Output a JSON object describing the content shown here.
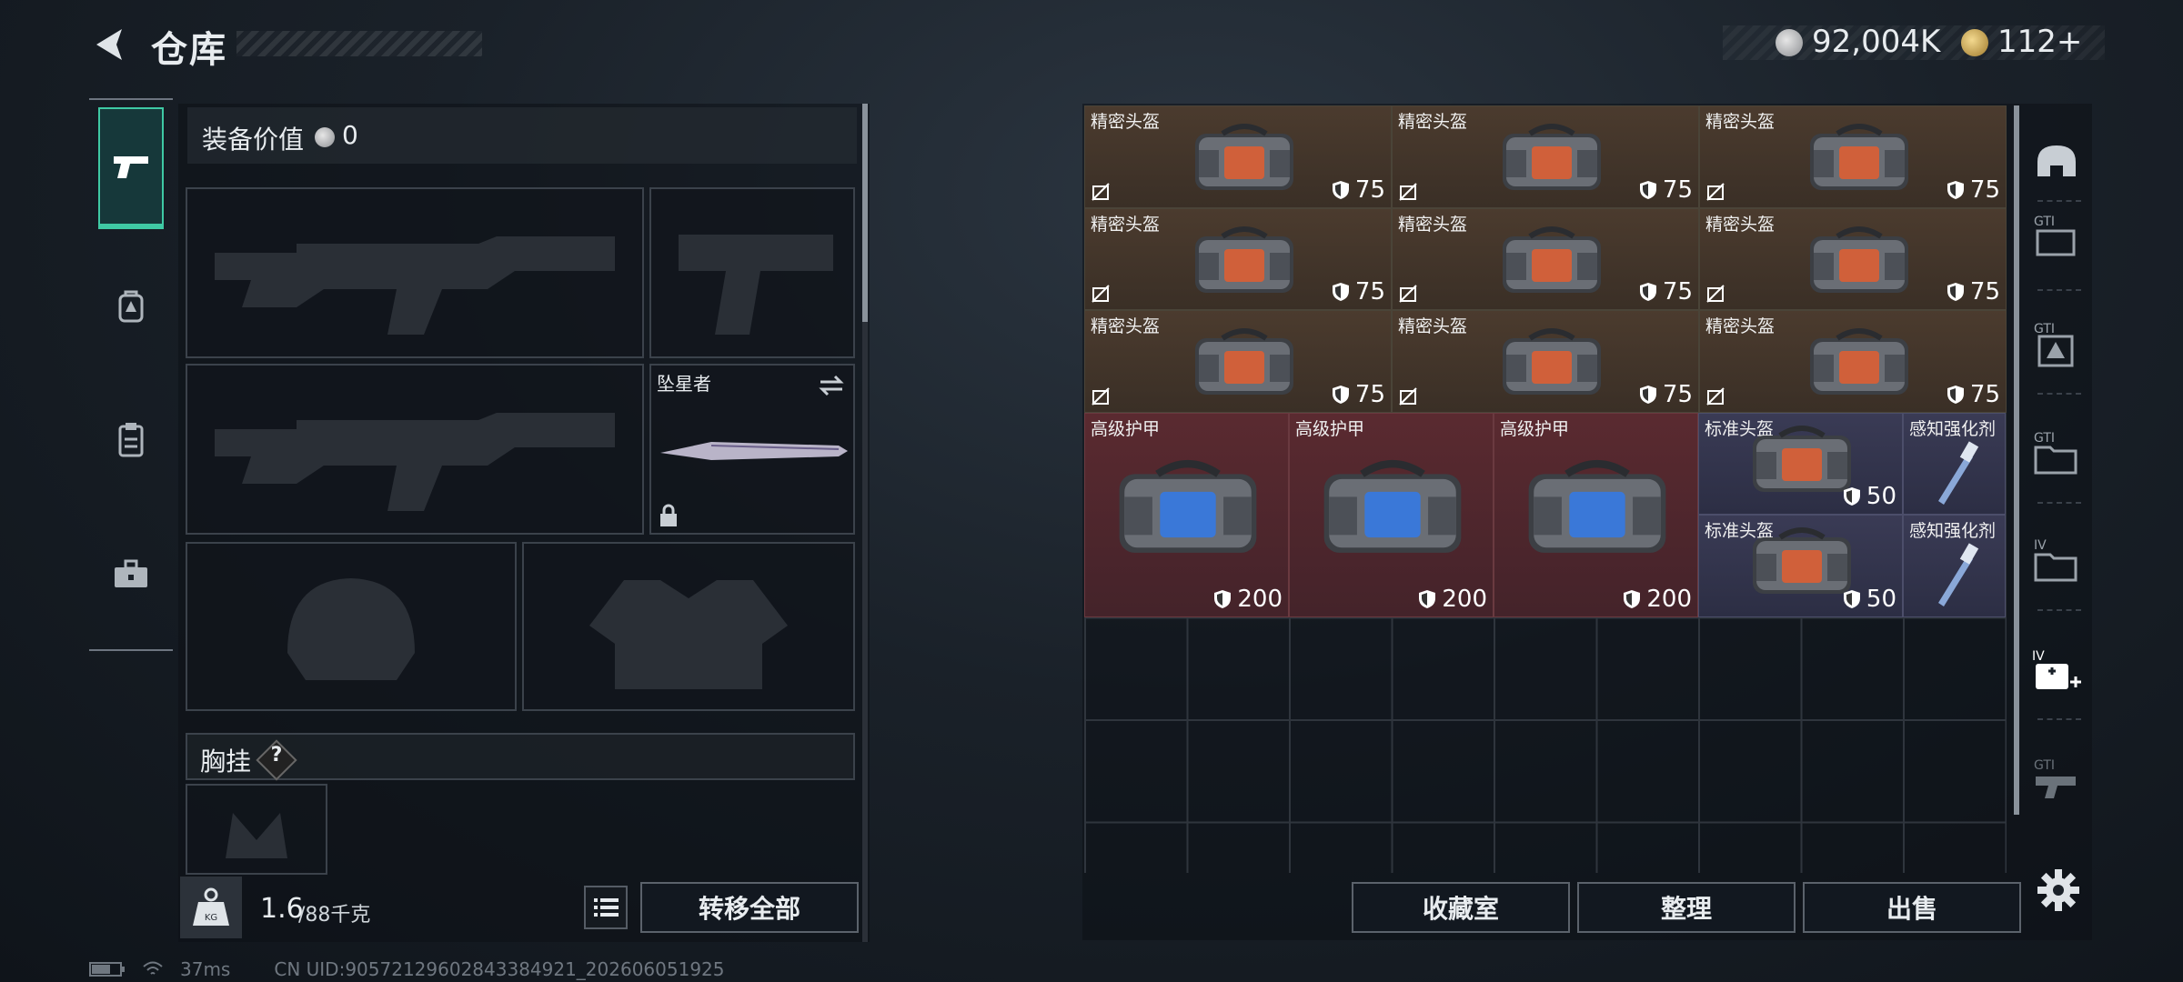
{
  "header": {
    "title": "仓库"
  },
  "currency": {
    "coin_a": "92,004K",
    "coin_b": "112+"
  },
  "equipment": {
    "value_label": "装备价值",
    "value": "0"
  },
  "knife_slot": {
    "name": "坠星者"
  },
  "vest": {
    "label": "胸挂",
    "help": "?"
  },
  "footer_left": {
    "weight": "1.6",
    "weight_unit": "/88千克",
    "transfer_all": "转移全部",
    "weight_icon_text": "KG"
  },
  "footer_right": {
    "collection": "收藏室",
    "organize": "整理",
    "sell": "出售"
  },
  "status": {
    "ping": "37ms",
    "uid": "CN UID:9057212960284338492​1_202606051925"
  },
  "inventory": {
    "items": [
      {
        "name": "精密头盔",
        "dur": "75",
        "kind": "brown"
      },
      {
        "name": "精密头盔",
        "dur": "75",
        "kind": "brown"
      },
      {
        "name": "精密头盔",
        "dur": "75",
        "kind": "brown"
      },
      {
        "name": "精密头盔",
        "dur": "75",
        "kind": "brown"
      },
      {
        "name": "精密头盔",
        "dur": "75",
        "kind": "brown"
      },
      {
        "name": "精密头盔",
        "dur": "75",
        "kind": "brown"
      },
      {
        "name": "精密头盔",
        "dur": "75",
        "kind": "brown"
      },
      {
        "name": "精密头盔",
        "dur": "75",
        "kind": "brown"
      },
      {
        "name": "精密头盔",
        "dur": "75",
        "kind": "brown"
      },
      {
        "name": "高级护甲",
        "dur": "200",
        "kind": "red"
      },
      {
        "name": "高级护甲",
        "dur": "200",
        "kind": "red"
      },
      {
        "name": "高级护甲",
        "dur": "200",
        "kind": "red"
      },
      {
        "name": "标准头盔",
        "dur": "50",
        "kind": "blue"
      },
      {
        "name": "标准头盔",
        "dur": "50",
        "kind": "blue"
      },
      {
        "name": "感知强化剂",
        "dur": "",
        "kind": "blue"
      },
      {
        "name": "感知强化剂",
        "dur": "",
        "kind": "blue"
      }
    ]
  },
  "side_icons": [
    "helmet-icon",
    "gti-card-icon",
    "gti-armor-icon",
    "gti-folder-icon",
    "iv-folder-icon",
    "iv-medkit-icon",
    "gti-gun-icon"
  ],
  "colors": {
    "accent": "#3fc9a4",
    "brown_cell": "#4b3b2e",
    "red_cell": "#5a2a30",
    "blue_cell": "#3a3b55"
  }
}
